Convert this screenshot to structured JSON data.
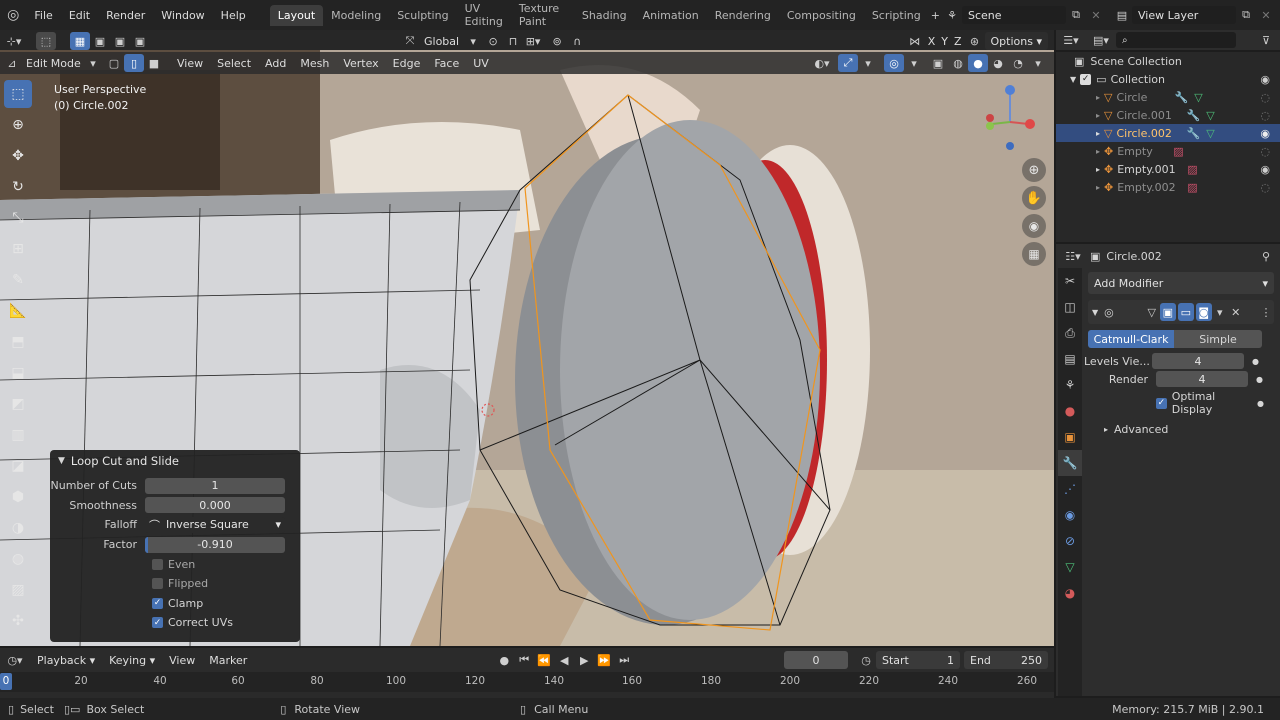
{
  "menu": [
    "File",
    "Edit",
    "Render",
    "Window",
    "Help"
  ],
  "workspaces": [
    "Layout",
    "Modeling",
    "Sculpting",
    "UV Editing",
    "Texture Paint",
    "Shading",
    "Animation",
    "Rendering",
    "Compositing",
    "Scripting"
  ],
  "active_workspace": "Layout",
  "scene": {
    "name": "Scene",
    "view_layer": "View Layer"
  },
  "viewport_header": {
    "transform_orientation": "Global",
    "axes": [
      "X",
      "Y",
      "Z"
    ],
    "options": "Options"
  },
  "edit_header": {
    "mode": "Edit Mode",
    "menus": [
      "View",
      "Select",
      "Add",
      "Mesh",
      "Vertex",
      "Edge",
      "Face",
      "UV"
    ]
  },
  "viewport_info": {
    "perspective": "User Perspective",
    "object": "(0) Circle.002"
  },
  "op_panel": {
    "title": "Loop Cut and Slide",
    "fields": [
      {
        "label": "Number of Cuts",
        "value": "1"
      },
      {
        "label": "Smoothness",
        "value": "0.000"
      },
      {
        "label": "Falloff",
        "value": "Inverse Square"
      },
      {
        "label": "Factor",
        "value": "-0.910"
      }
    ],
    "checkboxes": [
      {
        "label": "Even",
        "checked": false
      },
      {
        "label": "Flipped",
        "checked": false
      },
      {
        "label": "Clamp",
        "checked": true
      },
      {
        "label": "Correct UVs",
        "checked": true
      }
    ]
  },
  "outliner": {
    "root": "Scene Collection",
    "collection": "Collection",
    "items": [
      {
        "name": "Circle",
        "state": "dim"
      },
      {
        "name": "Circle.001",
        "state": "dim"
      },
      {
        "name": "Circle.002",
        "state": "selected"
      },
      {
        "name": "Empty",
        "state": "dim"
      },
      {
        "name": "Empty.001",
        "state": "normal"
      },
      {
        "name": "Empty.002",
        "state": "dim"
      }
    ]
  },
  "properties": {
    "object_name": "Circle.002",
    "add_modifier": "Add Modifier",
    "subdiv_types": [
      "Catmull-Clark",
      "Simple"
    ],
    "levels_label": "Levels Vie...",
    "levels_value": "4",
    "render_label": "Render",
    "render_value": "4",
    "optimal_display": "Optimal Display",
    "advanced": "Advanced"
  },
  "timeline": {
    "menus": [
      "Playback",
      "Keying",
      "View",
      "Marker"
    ],
    "current_frame": "0",
    "start_label": "Start",
    "start": "1",
    "end_label": "End",
    "end": "250",
    "ticks": [
      "0",
      "20",
      "40",
      "60",
      "80",
      "100",
      "120",
      "140",
      "160",
      "180",
      "200",
      "220",
      "240",
      "260"
    ]
  },
  "status": {
    "select": "Select",
    "box_select": "Box Select",
    "rotate_view": "Rotate View",
    "call_menu": "Call Menu",
    "memory": "Memory: 215.7 MiB | 2.90.1"
  },
  "colors": {
    "accent": "#4772b3",
    "selected_text": "#ffc36b",
    "edit_orange": "#ff9e2e",
    "red_part": "#c0282a"
  }
}
